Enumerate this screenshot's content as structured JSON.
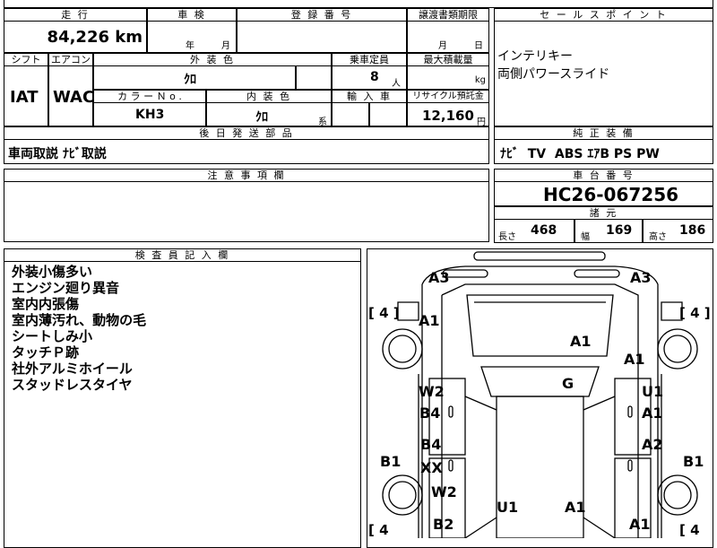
{
  "header": {
    "mileage_label": "走 行",
    "inspection_label": "車 検",
    "registration_label": "登 録 番 号",
    "transfer_label": "譲渡書類期限",
    "sales_point_label": "セ ー ル ス ポ イ ン ト",
    "mileage_value": "84,226 km",
    "inspection_year": "年",
    "inspection_month": "月",
    "transfer_month": "月",
    "transfer_day": "日"
  },
  "specs": {
    "shift_label": "シフト",
    "aircon_label": "エアコン",
    "exterior_label": "外 装 色",
    "capacity_label": "乗車定員",
    "max_load_label": "最大積載量",
    "shift_value": "IAT",
    "aircon_value": "WAC",
    "exterior_value": "ｸﾛ",
    "capacity_value": "8",
    "capacity_unit": "人",
    "max_load_unit": "kg",
    "color_no_label": "カ ラ ー Ｎ o .",
    "interior_label": "内 装 色",
    "import_label": "輸 入 車",
    "recycle_label": "リサイクル預託金",
    "color_no_value": "KH3",
    "interior_value": "ｸﾛ",
    "interior_suffix": "系",
    "recycle_value": "12,160",
    "recycle_unit": "円"
  },
  "sales_points": [
    "インテリキー",
    "両側パワースライド"
  ],
  "later_parts": {
    "label": "後 日 発 送 部 品",
    "value": "車両取説 ﾅﾋﾞ取説"
  },
  "equipment": {
    "label": "純 正 装 備",
    "value": "ﾅﾋﾞ  TV  ABS ｴｱB PS PW"
  },
  "caution": {
    "label": "注 意 事 項 欄"
  },
  "chassis": {
    "label": "車 台 番 号",
    "value": "HC26-067256"
  },
  "dimensions": {
    "label": "諸 元",
    "length_label": "長さ",
    "length_value": "468",
    "width_label": "幅",
    "width_value": "169",
    "height_label": "高さ",
    "height_value": "186"
  },
  "inspector": {
    "label": "検 査 員 記 入 欄",
    "remarks": [
      "外装小傷多い",
      "エンジン廻り異音",
      "室内内張傷",
      "室内薄汚れ、動物の毛",
      "シートしみ小",
      "タッチＰ跡",
      "社外アルミホイール",
      "スタッドレスタイヤ"
    ]
  },
  "diagram": {
    "a3_left": "A3",
    "a3_right": "A3",
    "bracket_tl": "[ 4 ]",
    "bracket_tr": "[ 4 ]",
    "bracket_bl": "[ 4",
    "bracket_br": "[ 4",
    "a1_front_left": "A1",
    "a1_hood": "A1",
    "a1_front_right": "A1",
    "g_windshield": "G",
    "w2_front_door": "W2",
    "b4_front_door": "B4",
    "u1_right_door": "U1",
    "a1_right_door": "A1",
    "b4_rear_door": "B4",
    "xx_rear_door": "XX",
    "a2_rear_right": "A2",
    "b1_left": "B1",
    "b1_right": "B1",
    "w2_rear_left": "W2",
    "b2_rear_left": "B2",
    "u1_rear": "U1",
    "a1_rear_center": "A1",
    "a1_rear_right": "A1"
  }
}
